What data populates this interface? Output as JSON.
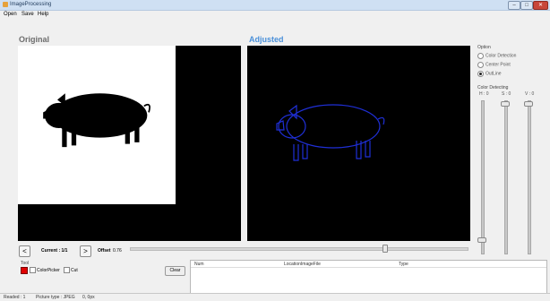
{
  "window": {
    "title": "ImageProcessing",
    "minimize": "–",
    "maximize": "□",
    "close": "✕"
  },
  "menu": {
    "items": [
      "Open",
      "Save",
      "Help"
    ]
  },
  "panels": {
    "original_title": "Original",
    "adjusted_title": "Adjusted"
  },
  "option": {
    "label": "Option",
    "radios": [
      {
        "label": "Color Detection",
        "checked": false
      },
      {
        "label": "Center Point",
        "checked": false
      },
      {
        "label": "OutLine",
        "checked": true
      }
    ]
  },
  "color_detecting": {
    "label": "Color Detecting",
    "h": "H : 0",
    "s": "S : 0",
    "v": "V : 0"
  },
  "nav": {
    "prev": "<",
    "next": ">",
    "current": "Current : 1/1",
    "offset_label": "Offset",
    "offset_value": "0.76"
  },
  "tool": {
    "label": "Tool",
    "colorpicker": "ColorPicker",
    "cut": "Cut",
    "clear": "Clear",
    "swatch_color": "#e00000"
  },
  "list": {
    "columns": [
      "Num",
      "LocationImageFile",
      "Type"
    ]
  },
  "status": {
    "readed": "Readed : 1",
    "picture_type": "Picture type : JPEG",
    "size": "0, 0px"
  },
  "colors": {
    "outline": "#1f2fd6",
    "silhouette": "#000000",
    "accent": "#4a90d9"
  }
}
